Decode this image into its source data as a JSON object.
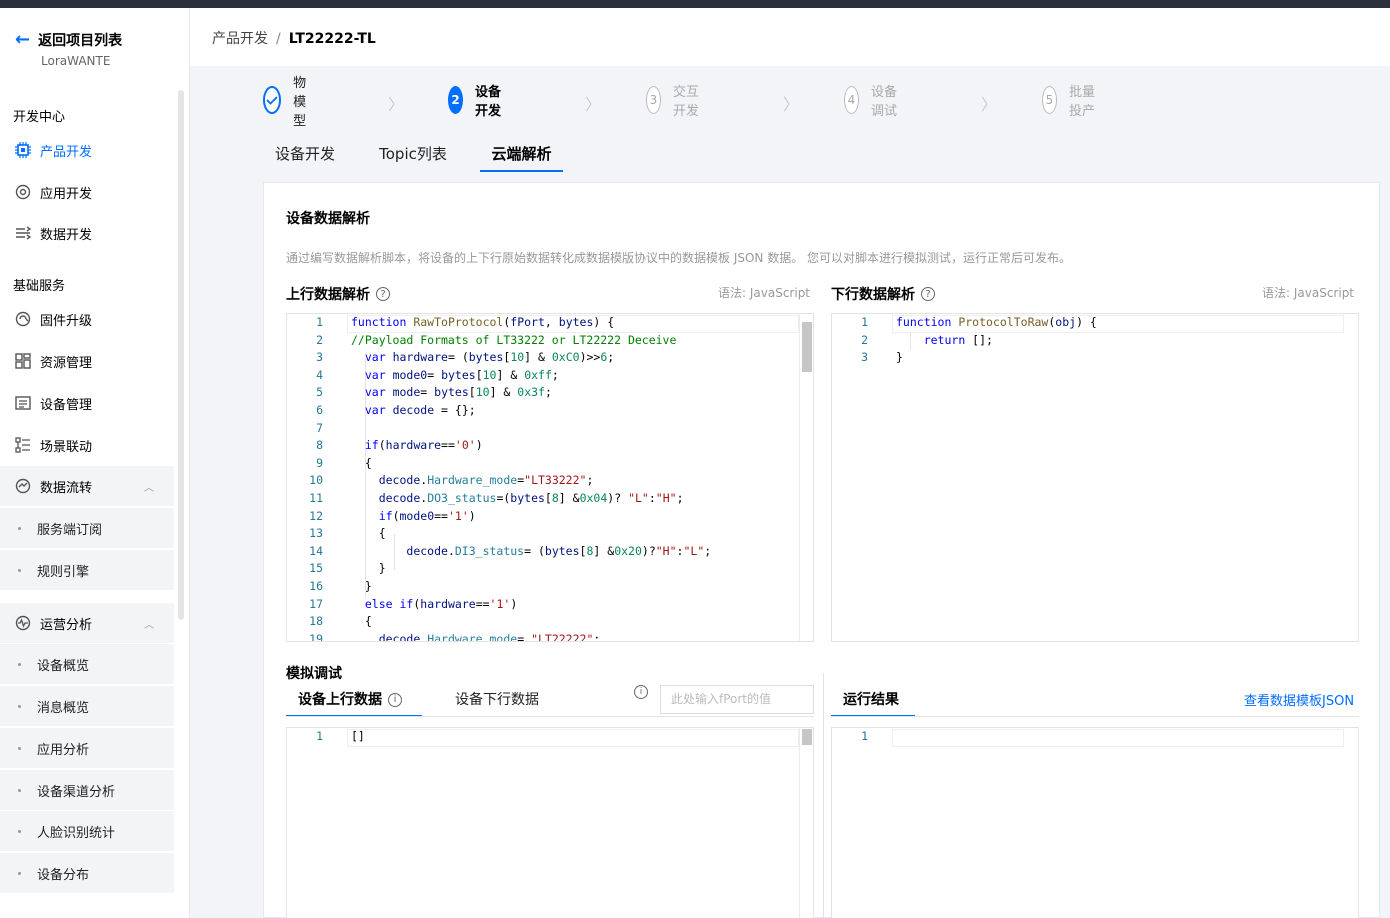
{
  "sidebar": {
    "back_label": "返回项目列表",
    "project_name": "LoraWANTE",
    "sections": [
      {
        "title": "开发中心"
      },
      {
        "title": "基础服务"
      }
    ],
    "items": [
      {
        "label": "产品开发",
        "icon": "chip-icon"
      },
      {
        "label": "应用开发",
        "icon": "app-icon"
      },
      {
        "label": "数据开发",
        "icon": "data-icon"
      },
      {
        "label": "固件升级",
        "icon": "firmware-icon"
      },
      {
        "label": "资源管理",
        "icon": "resource-icon"
      },
      {
        "label": "设备管理",
        "icon": "device-icon"
      },
      {
        "label": "场景联动",
        "icon": "scene-icon"
      },
      {
        "label": "数据流转",
        "icon": "flow-icon"
      },
      {
        "label": "运营分析",
        "icon": "analysis-icon"
      }
    ],
    "sub_flow": [
      "服务端订阅",
      "规则引擎"
    ],
    "sub_analysis": [
      "设备概览",
      "消息概览",
      "应用分析",
      "设备渠道分析",
      "人脸识别统计",
      "设备分布"
    ]
  },
  "header": {
    "crumb_parent": "产品开发",
    "crumb_sep": "/",
    "crumb_current": "LT22222-TL"
  },
  "steps": [
    {
      "num": "",
      "label": "物模型",
      "state": "done"
    },
    {
      "num": "2",
      "label": "设备开发",
      "state": "current"
    },
    {
      "num": "3",
      "label": "交互开发",
      "state": "todo"
    },
    {
      "num": "4",
      "label": "设备调试",
      "state": "todo"
    },
    {
      "num": "5",
      "label": "批量投产",
      "state": "todo"
    }
  ],
  "tabs": [
    "设备开发",
    "Topic列表",
    "云端解析"
  ],
  "card": {
    "title": "设备数据解析",
    "desc": "通过编写数据解析脚本，将设备的上下行原始数据转化成数据模版协议中的数据模板 JSON 数据。 您可以对脚本进行模拟测试，运行正常后可发布。",
    "up_title": "上行数据解析",
    "down_title": "下行数据解析",
    "lang_label": "语法: JavaScript",
    "sim_title": "模拟调试",
    "sim_tabs": [
      "设备上行数据",
      "设备下行数据"
    ],
    "fport_placeholder": "此处输入fPort的值",
    "result_tab": "运行结果",
    "view_json_link": "查看数据模板JSON",
    "sim_input": "[]",
    "help_glyph": "?",
    "info_glyph": "i"
  },
  "up_line_numbers": [
    "1",
    "2",
    "3",
    "4",
    "5",
    "6",
    "7",
    "8",
    "9",
    "10",
    "11",
    "12",
    "13",
    "14",
    "15",
    "16",
    "17",
    "18",
    "19"
  ],
  "down_line_numbers": [
    "1",
    "2",
    "3"
  ],
  "sim_line_numbers": [
    "1"
  ],
  "colors": {
    "accent": "#006eff",
    "sidebar_bg": "#ffffff",
    "page_bg": "#f2f4f7"
  }
}
